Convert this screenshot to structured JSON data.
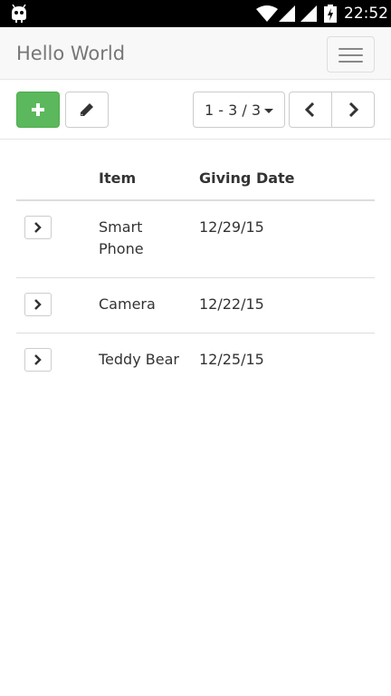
{
  "status_bar": {
    "time": "22:52",
    "icons": [
      "android-debug-icon",
      "wifi-icon",
      "signal-icon",
      "signal-icon",
      "battery-charging-icon"
    ]
  },
  "navbar": {
    "brand": "Hello World",
    "toggle_icon": "hamburger-menu-icon"
  },
  "toolbar": {
    "add_icon": "plus-icon",
    "edit_icon": "pencil-icon",
    "pager_label": "1 - 3 / 3",
    "pager_icon": "caret-down-icon",
    "prev_icon": "chevron-left-icon",
    "next_icon": "chevron-right-icon"
  },
  "colors": {
    "add_button": "#5cb85c",
    "navbar_bg": "#f8f8f8",
    "status_bar_bg": "#000000"
  },
  "table": {
    "headers": [
      "",
      "Item",
      "Giving Date"
    ],
    "rows": [
      {
        "item": "Smart Phone",
        "date": "12/29/15",
        "expand_icon": "chevron-right-icon"
      },
      {
        "item": "Camera",
        "date": "12/22/15",
        "expand_icon": "chevron-right-icon"
      },
      {
        "item": "Teddy Bear",
        "date": "12/25/15",
        "expand_icon": "chevron-right-icon"
      }
    ]
  }
}
